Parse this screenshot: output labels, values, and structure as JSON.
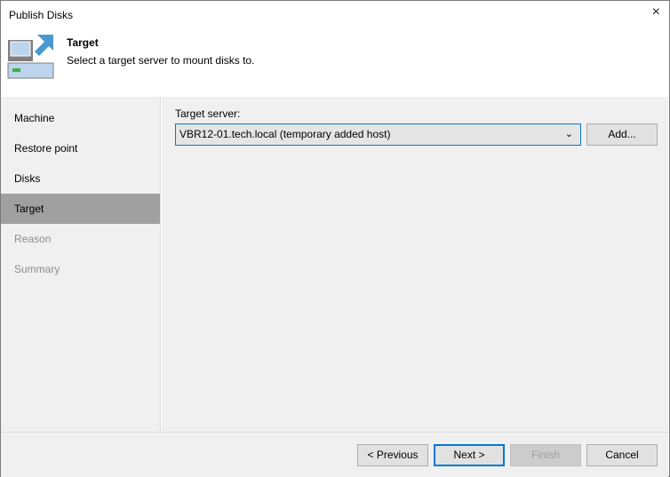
{
  "window": {
    "title": "Publish Disks",
    "close_icon": "×"
  },
  "header": {
    "title": "Target",
    "subtitle": "Select a target server to mount disks to."
  },
  "steps": [
    {
      "label": "Machine",
      "state": "done"
    },
    {
      "label": "Restore point",
      "state": "done"
    },
    {
      "label": "Disks",
      "state": "done"
    },
    {
      "label": "Target",
      "state": "active"
    },
    {
      "label": "Reason",
      "state": "disabled"
    },
    {
      "label": "Summary",
      "state": "disabled"
    }
  ],
  "main": {
    "target_label": "Target server:",
    "target_value": "VBR12-01.tech.local (temporary added host)",
    "add_label": "Add..."
  },
  "footer": {
    "previous": "< Previous",
    "next": "Next >",
    "finish": "Finish",
    "cancel": "Cancel"
  }
}
